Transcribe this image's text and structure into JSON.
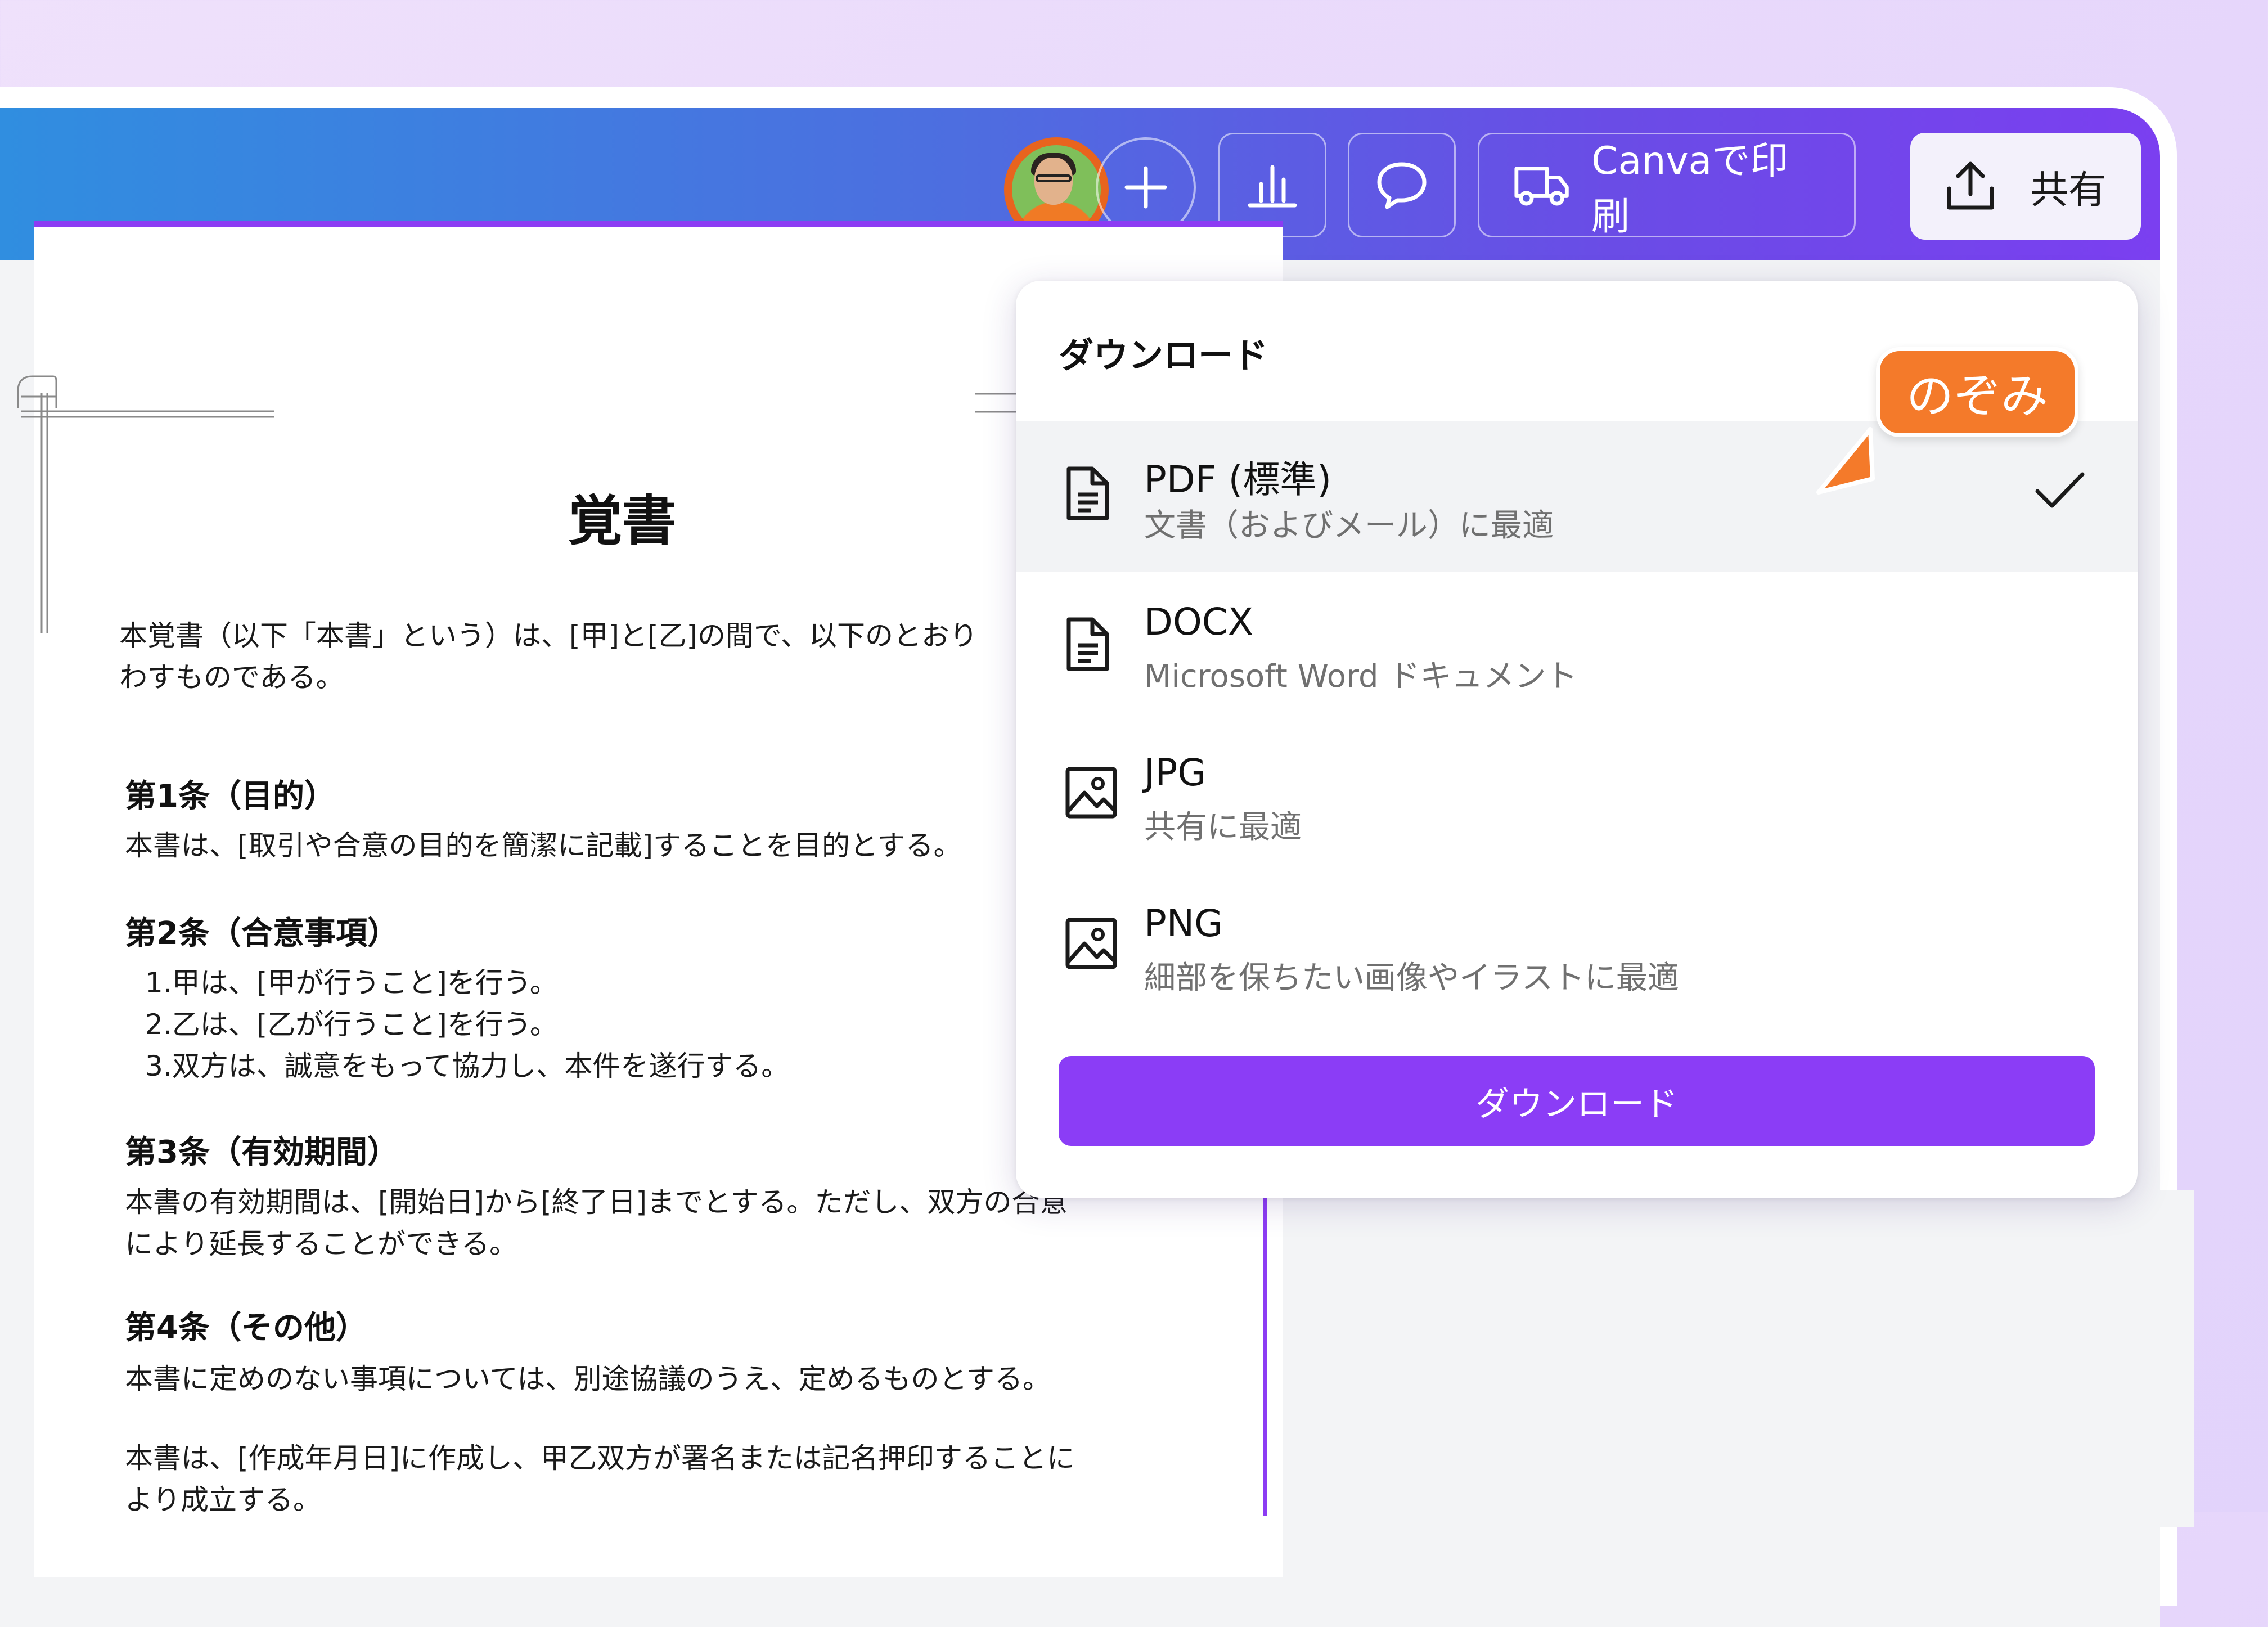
{
  "header": {
    "print_button_label": "Canvaで印刷",
    "share_button_label": "共有",
    "icons": [
      "add-icon",
      "analytics-icon",
      "comment-icon",
      "truck-icon",
      "upload-icon"
    ]
  },
  "document": {
    "title": "覚書",
    "intro": "本覚書（以下「本書」という）は、[甲]と[乙]の間で、以下のとおり\nわすものである。",
    "sections": [
      {
        "heading": "第1条（目的）",
        "body": "本書は、[取引や合意の目的を簡潔に記載]することを目的とする。"
      },
      {
        "heading": "第2条（合意事項）",
        "body": "1.甲は、[甲が行うこと]を行う。\n2.乙は、[乙が行うこと]を行う。\n3.双方は、誠意をもって協力し、本件を遂行する。"
      },
      {
        "heading": "第3条（有効期間）",
        "body": "本書の有効期間は、[開始日]から[終了日]までとする。ただし、双方の合意\nにより延長することができる。"
      },
      {
        "heading": "第4条（その他）",
        "body": "本書に定めのない事項については、別途協議のうえ、定めるものとする。"
      }
    ],
    "closing": "本書は、[作成年月日]に作成し、甲乙双方が署名または記名押印することに\nより成立する。"
  },
  "download_panel": {
    "title": "ダウンロード",
    "options": [
      {
        "name": "PDF (標準)",
        "description": "文書（およびメール）に最適",
        "icon": "document-icon",
        "selected": true
      },
      {
        "name": "DOCX",
        "description": "Microsoft Word ドキュメント",
        "icon": "document-icon",
        "selected": false
      },
      {
        "name": "JPG",
        "description": "共有に最適",
        "icon": "image-icon",
        "selected": false
      },
      {
        "name": "PNG",
        "description": "細部を保ちたい画像やイラストに最適",
        "icon": "image-icon",
        "selected": false
      }
    ],
    "download_button_label": "ダウンロード"
  },
  "collaborator": {
    "name": "のぞみ",
    "color": "#f47a2a"
  },
  "colors": {
    "accent": "#8b3df6",
    "header_start": "#2f8fe0",
    "header_end": "#7b3ff0"
  }
}
